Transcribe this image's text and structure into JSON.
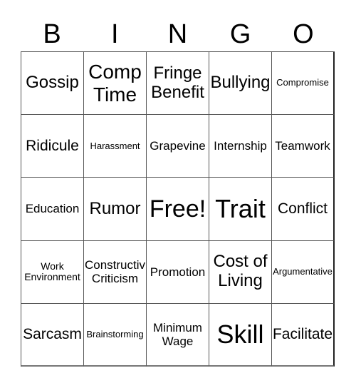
{
  "header": {
    "letters": [
      "B",
      "I",
      "N",
      "G",
      "O"
    ]
  },
  "cells": [
    [
      "Gossip",
      "Comp\nTime",
      "Fringe\nBenefit",
      "Bullying",
      "Compromise"
    ],
    [
      "Ridicule",
      "Harassment",
      "Grapevine",
      "Internship",
      "Teamwork"
    ],
    [
      "Education",
      "Rumor",
      "Free!",
      "Trait",
      "Conflict"
    ],
    [
      "Work\nEnvironment",
      "Constructiv\nCriticism",
      "Promotion",
      "Cost of\nLiving",
      "Argumentative"
    ],
    [
      "Sarcasm",
      "Brainstorming",
      "Minimum\nWage",
      "Skill",
      "Facilitate"
    ]
  ],
  "free_space": {
    "row": 2,
    "col": 2,
    "label": "Free!"
  }
}
